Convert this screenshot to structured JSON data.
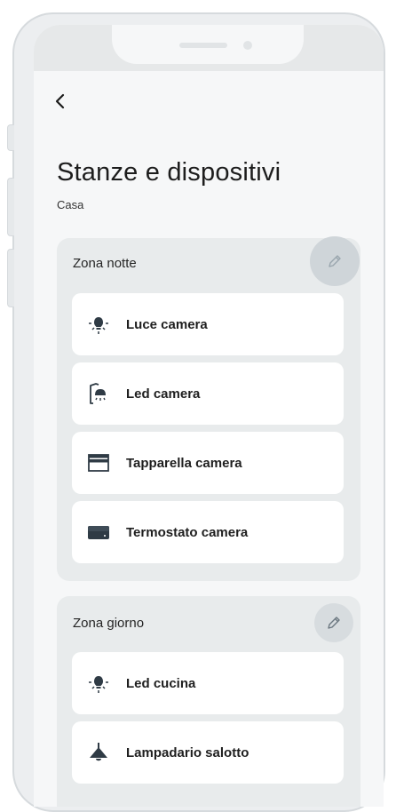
{
  "nav": {
    "back_icon": "chevron-left-icon",
    "back_glyph": "‹"
  },
  "header": {
    "title": "Stanze e dispositivi",
    "subtitle": "Casa"
  },
  "zones": [
    {
      "title": "Zona notte",
      "edit_icon": "pencil-icon",
      "devices": [
        {
          "label": "Luce camera",
          "icon": "bulb-icon"
        },
        {
          "label": "Led camera",
          "icon": "led-lamp-icon"
        },
        {
          "label": "Tapparella camera",
          "icon": "shutter-icon"
        },
        {
          "label": "Termostato camera",
          "icon": "thermostat-icon"
        }
      ]
    },
    {
      "title": "Zona giorno",
      "edit_icon": "pencil-icon",
      "devices": [
        {
          "label": "Led cucina",
          "icon": "bulb-icon"
        },
        {
          "label": "Lampadario salotto",
          "icon": "chandelier-icon"
        }
      ]
    }
  ],
  "colors": {
    "icon": "#2f3b45",
    "accent_edit": "#9aa6ae",
    "card_bg": "#ffffff",
    "zone_bg": "#e8ebec"
  }
}
